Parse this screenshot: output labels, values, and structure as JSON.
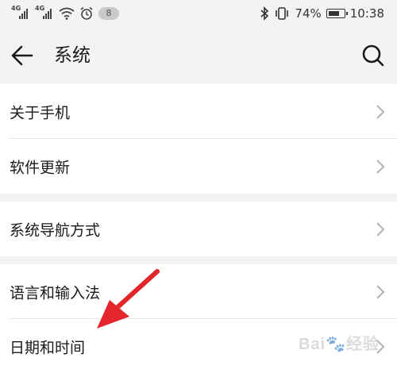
{
  "status_bar": {
    "signal_1": "4G",
    "signal_2": "4G",
    "notification_count": "8",
    "battery_percent": "74%",
    "battery_level": 0.74,
    "time": "10:38",
    "icons": [
      "signal-icon",
      "wifi-icon",
      "alarm-icon",
      "bluetooth-icon",
      "vibrate-icon",
      "battery-icon"
    ]
  },
  "header": {
    "title": "系统",
    "back_icon": "back-arrow-icon",
    "search_icon": "search-icon"
  },
  "sections": [
    {
      "items": [
        {
          "label": "关于手机"
        },
        {
          "label": "软件更新"
        }
      ]
    },
    {
      "items": [
        {
          "label": "系统导航方式"
        }
      ]
    },
    {
      "items": [
        {
          "label": "语言和输入法"
        },
        {
          "label": "日期和时间"
        }
      ]
    }
  ],
  "watermark": "Bai🐾经验",
  "colors": {
    "background": "#f3f3f3",
    "row_background": "#ffffff",
    "annotation_arrow": "#e3262c"
  }
}
